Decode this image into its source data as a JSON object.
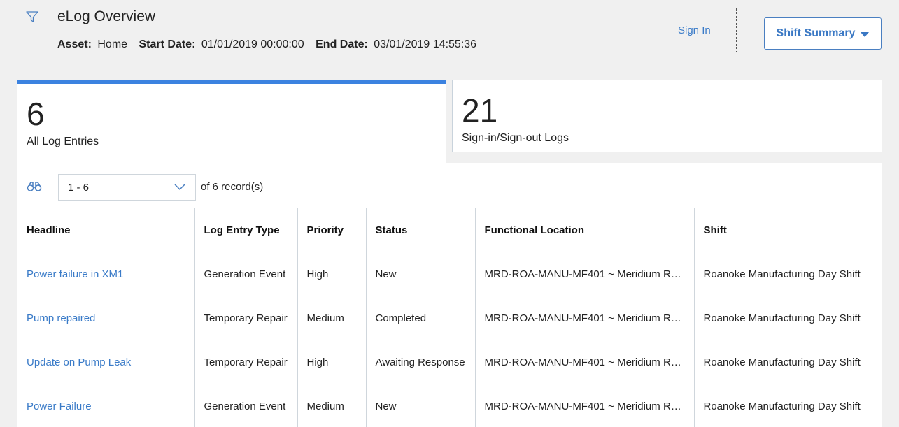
{
  "header": {
    "title": "eLog Overview",
    "asset_label": "Asset:",
    "asset_value": "Home",
    "start_label": "Start Date:",
    "start_value": "01/01/2019 00:00:00",
    "end_label": "End Date:",
    "end_value": "03/01/2019 14:55:36",
    "sign_in": "Sign In",
    "shift_summary": "Shift Summary"
  },
  "tabs": [
    {
      "count": "6",
      "label": "All Log Entries"
    },
    {
      "count": "21",
      "label": "Sign-in/Sign-out Logs"
    }
  ],
  "pager": {
    "range": "1 - 6",
    "of_text": "of 6  record(s)"
  },
  "table": {
    "headers": [
      "Headline",
      "Log Entry Type",
      "Priority",
      "Status",
      "Functional Location",
      "Shift"
    ],
    "rows": [
      [
        "Power failure in XM1",
        "Generation Event",
        "High",
        "New",
        "MRD-ROA-MANU-MF401 ~ Meridium Ro...",
        "Roanoke Manufacturing Day Shift"
      ],
      [
        "Pump repaired",
        "Temporary Repair",
        "Medium",
        "Completed",
        "MRD-ROA-MANU-MF401 ~ Meridium Ro...",
        "Roanoke Manufacturing Day Shift"
      ],
      [
        "Update on Pump Leak",
        "Temporary Repair",
        "High",
        "Awaiting Response",
        "MRD-ROA-MANU-MF401 ~ Meridium Ro...",
        "Roanoke Manufacturing Day Shift"
      ],
      [
        "Power Failure",
        "Generation Event",
        "Medium",
        "New",
        "MRD-ROA-MANU-MF401 ~ Meridium Ro...",
        "Roanoke Manufacturing Day Shift"
      ]
    ]
  },
  "colors": {
    "accent": "#3b82e0",
    "link": "#3a7bc8"
  },
  "icons": {
    "filter": "filter-icon",
    "search": "binoculars-icon",
    "dropdown": "chevron-down-icon"
  }
}
